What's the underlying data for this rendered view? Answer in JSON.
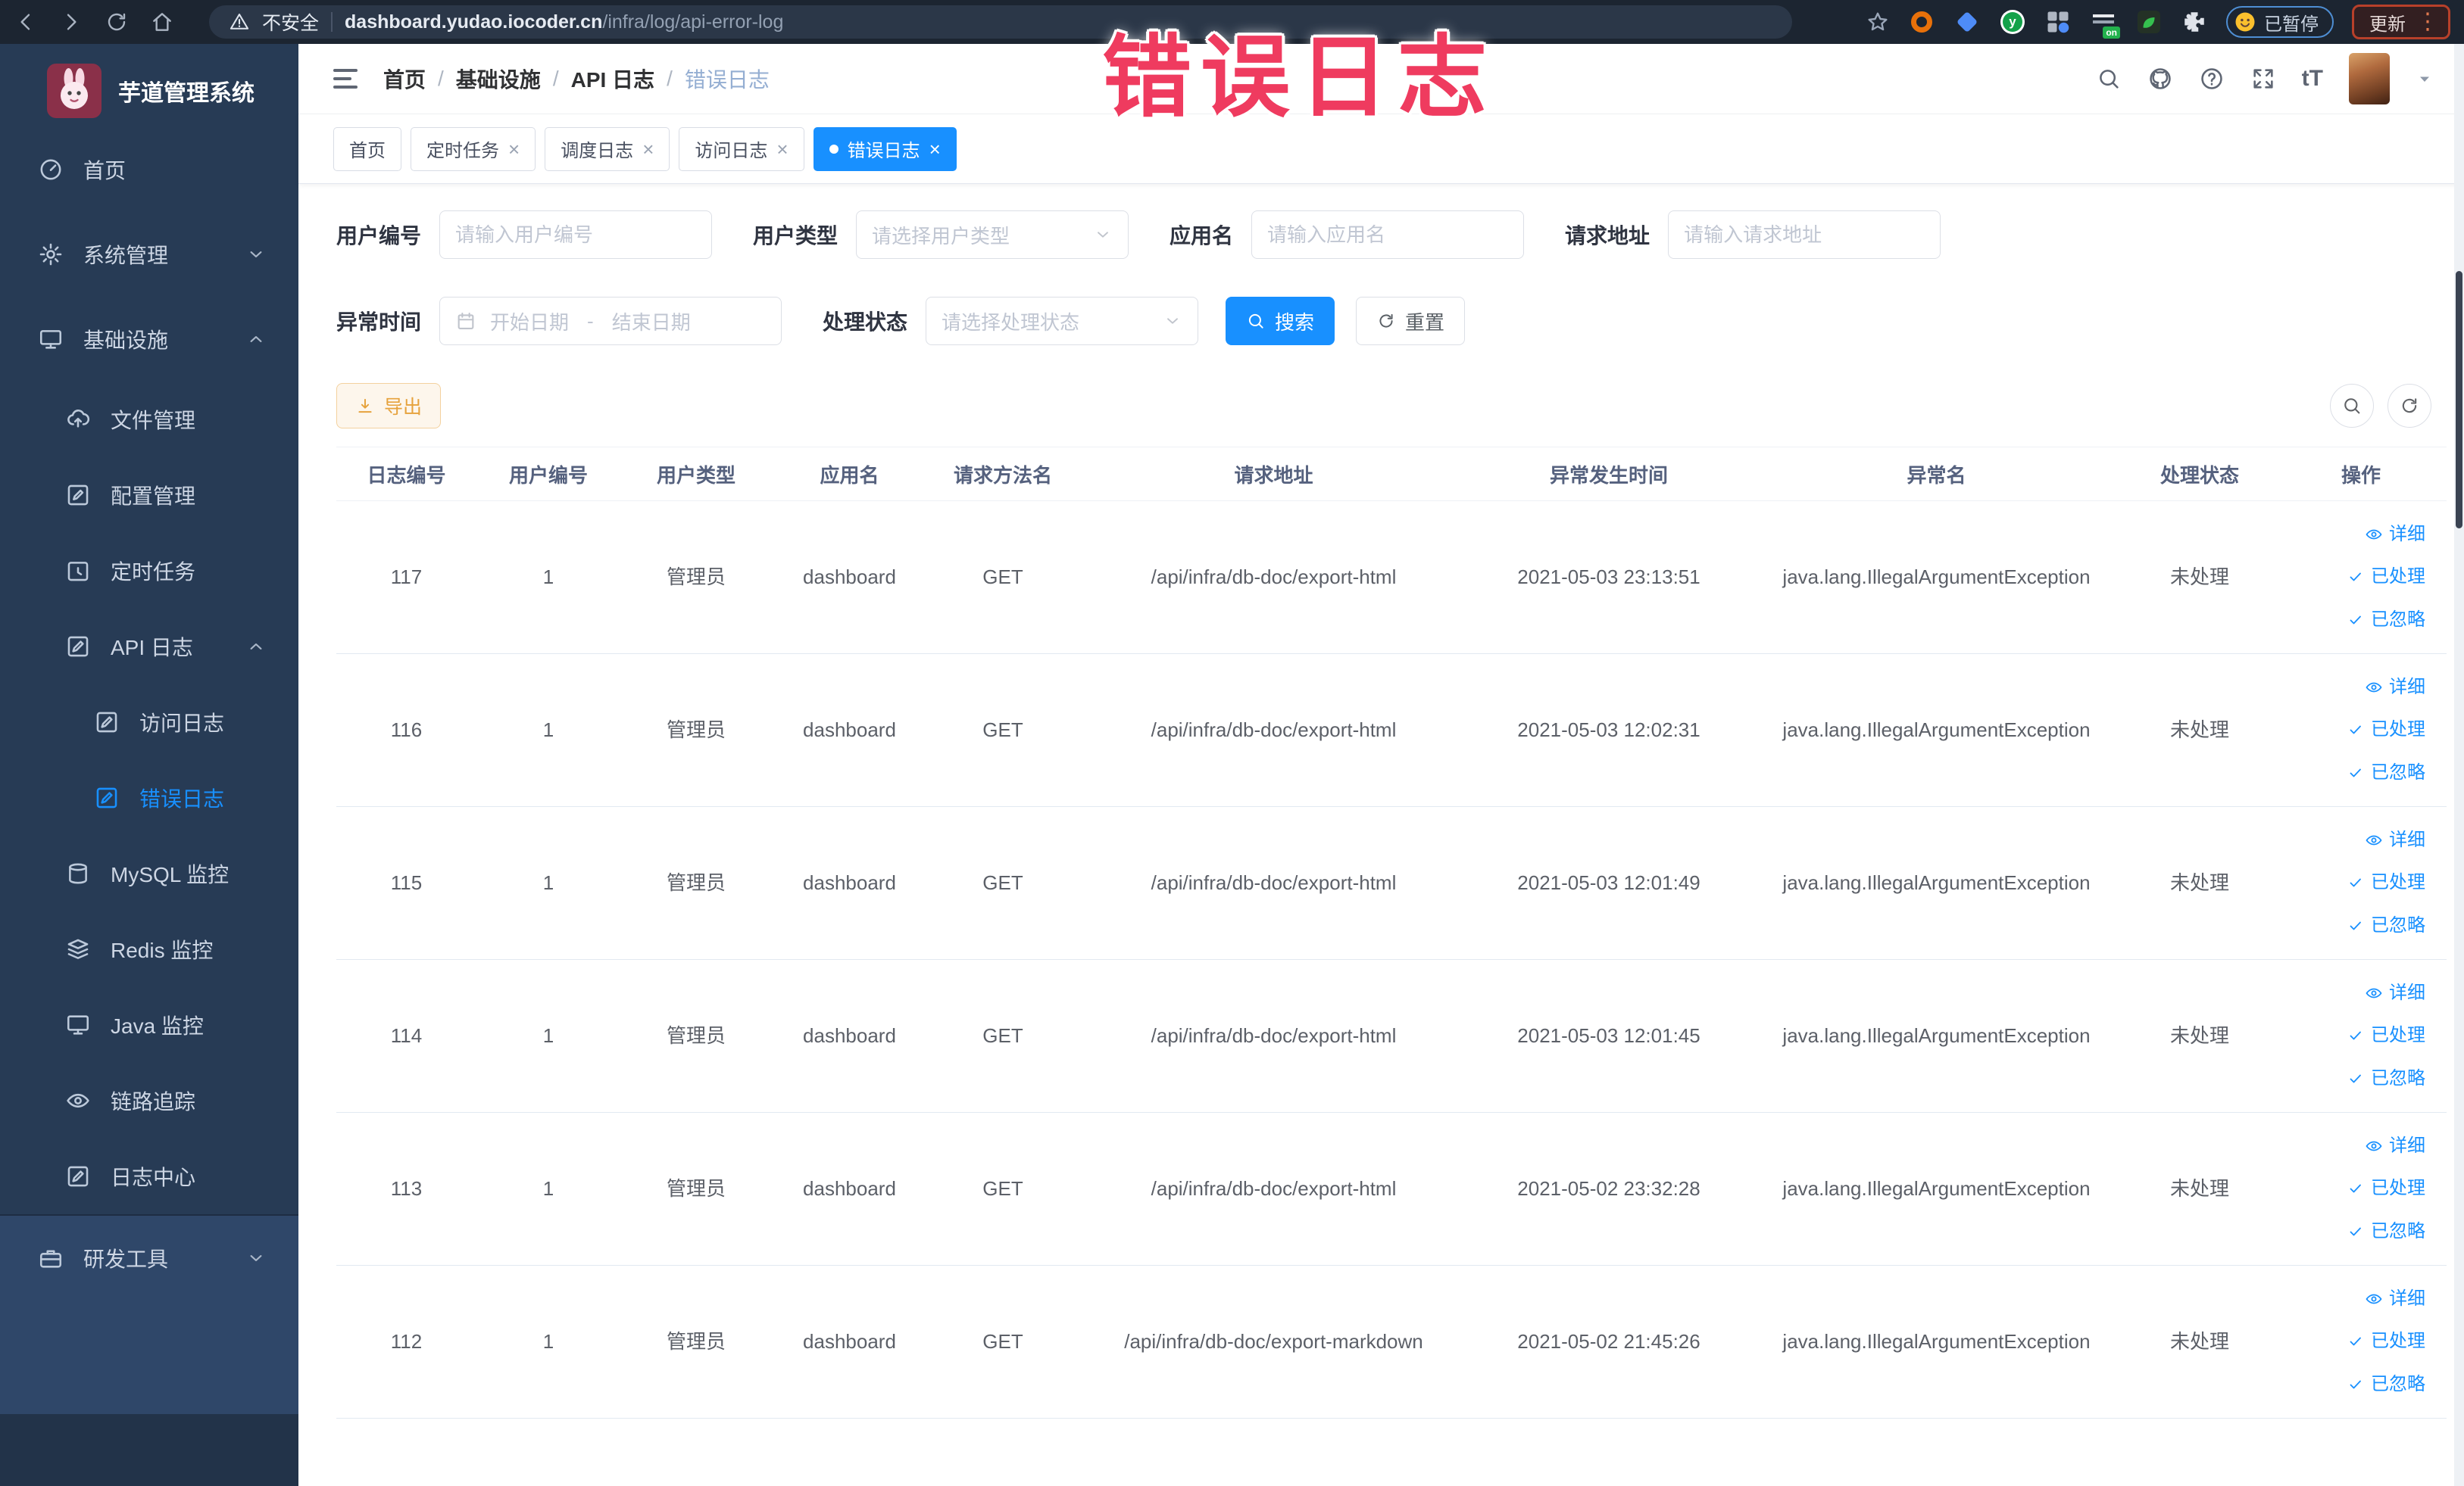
{
  "browser": {
    "security_label": "不安全",
    "url_host": "dashboard.yudao.iocoder.cn",
    "url_path": "/infra/log/api-error-log",
    "paused_badge": "已暂停",
    "update_button": "更新",
    "extensions": [
      {
        "name": "ext-orange-icon",
        "kind": "orange"
      },
      {
        "name": "ext-blue-icon",
        "kind": "blue"
      },
      {
        "name": "ext-green-icon",
        "kind": "green",
        "glyph": "y"
      },
      {
        "name": "ext-grid-icon",
        "kind": "grid"
      },
      {
        "name": "ext-switch-on-icon",
        "kind": "switch",
        "badge": "on"
      },
      {
        "name": "ext-leaf-icon",
        "kind": "leaf"
      },
      {
        "name": "extensions-puzzle-icon",
        "kind": "puzzle"
      }
    ]
  },
  "annotation": {
    "text": "错误日志"
  },
  "sidebar": {
    "title": "芋道管理系统",
    "items": [
      {
        "key": "home",
        "label": "首页",
        "icon": "home-icon",
        "level": 1
      },
      {
        "key": "system",
        "label": "系统管理",
        "icon": "gear-icon",
        "level": 1,
        "chevron": "down"
      },
      {
        "key": "infra",
        "label": "基础设施",
        "icon": "infrastructure-icon",
        "level": 1,
        "chevron": "up"
      },
      {
        "key": "file",
        "label": "文件管理",
        "icon": "file-upload-icon",
        "level": 2
      },
      {
        "key": "config",
        "label": "配置管理",
        "icon": "config-icon",
        "level": 2
      },
      {
        "key": "job",
        "label": "定时任务",
        "icon": "timer-icon",
        "level": 2
      },
      {
        "key": "api-log",
        "label": "API 日志",
        "icon": "api-log-icon",
        "level": 2,
        "chevron": "up"
      },
      {
        "key": "access-log",
        "label": "访问日志",
        "icon": "access-log-icon",
        "level": 3
      },
      {
        "key": "error-log",
        "label": "错误日志",
        "icon": "error-log-icon",
        "level": 3,
        "active": true
      },
      {
        "key": "mysql",
        "label": "MySQL 监控",
        "icon": "mysql-icon",
        "level": 2
      },
      {
        "key": "redis",
        "label": "Redis 监控",
        "icon": "redis-icon",
        "level": 2
      },
      {
        "key": "java",
        "label": "Java 监控",
        "icon": "java-icon",
        "level": 2
      },
      {
        "key": "trace",
        "label": "链路追踪",
        "icon": "trace-icon",
        "level": 2
      },
      {
        "key": "log-center",
        "label": "日志中心",
        "icon": "log-center-icon",
        "level": 2
      },
      {
        "key": "dev-tools",
        "label": "研发工具",
        "icon": "devtools-icon",
        "level": 1,
        "chevron": "down",
        "section": "alt"
      }
    ]
  },
  "breadcrumb": {
    "items": [
      "首页",
      "基础设施",
      "API 日志"
    ],
    "current": "错误日志"
  },
  "tabs": [
    {
      "label": "首页",
      "closable": false,
      "active": false
    },
    {
      "label": "定时任务",
      "closable": true,
      "active": false
    },
    {
      "label": "调度日志",
      "closable": true,
      "active": false
    },
    {
      "label": "访问日志",
      "closable": true,
      "active": false
    },
    {
      "label": "错误日志",
      "closable": true,
      "active": true
    }
  ],
  "filters": {
    "user_id": {
      "label": "用户编号",
      "placeholder": "请输入用户编号"
    },
    "user_type": {
      "label": "用户类型",
      "placeholder": "请选择用户类型"
    },
    "app_name": {
      "label": "应用名",
      "placeholder": "请输入应用名"
    },
    "request_url": {
      "label": "请求地址",
      "placeholder": "请输入请求地址"
    },
    "exception_time": {
      "label": "异常时间",
      "start_placeholder": "开始日期",
      "separator": "-",
      "end_placeholder": "结束日期"
    },
    "process_status": {
      "label": "处理状态",
      "placeholder": "请选择处理状态"
    },
    "search_label": "搜索",
    "reset_label": "重置"
  },
  "toolbar": {
    "export_label": "导出"
  },
  "table": {
    "columns": [
      {
        "key": "id",
        "label": "日志编号"
      },
      {
        "key": "user_id",
        "label": "用户编号"
      },
      {
        "key": "user_type",
        "label": "用户类型"
      },
      {
        "key": "app_name",
        "label": "应用名"
      },
      {
        "key": "method",
        "label": "请求方法名"
      },
      {
        "key": "url",
        "label": "请求地址"
      },
      {
        "key": "time",
        "label": "异常发生时间"
      },
      {
        "key": "exception",
        "label": "异常名"
      },
      {
        "key": "status",
        "label": "处理状态"
      },
      {
        "key": "actions",
        "label": "操作"
      }
    ],
    "rows": [
      {
        "id": "117",
        "user_id": "1",
        "user_type": "管理员",
        "app_name": "dashboard",
        "method": "GET",
        "url": "/api/infra/db-doc/export-html",
        "time": "2021-05-03 23:13:51",
        "exception": "java.lang.IllegalArgumentException",
        "status": "未处理"
      },
      {
        "id": "116",
        "user_id": "1",
        "user_type": "管理员",
        "app_name": "dashboard",
        "method": "GET",
        "url": "/api/infra/db-doc/export-html",
        "time": "2021-05-03 12:02:31",
        "exception": "java.lang.IllegalArgumentException",
        "status": "未处理"
      },
      {
        "id": "115",
        "user_id": "1",
        "user_type": "管理员",
        "app_name": "dashboard",
        "method": "GET",
        "url": "/api/infra/db-doc/export-html",
        "time": "2021-05-03 12:01:49",
        "exception": "java.lang.IllegalArgumentException",
        "status": "未处理"
      },
      {
        "id": "114",
        "user_id": "1",
        "user_type": "管理员",
        "app_name": "dashboard",
        "method": "GET",
        "url": "/api/infra/db-doc/export-html",
        "time": "2021-05-03 12:01:45",
        "exception": "java.lang.IllegalArgumentException",
        "status": "未处理"
      },
      {
        "id": "113",
        "user_id": "1",
        "user_type": "管理员",
        "app_name": "dashboard",
        "method": "GET",
        "url": "/api/infra/db-doc/export-html",
        "time": "2021-05-02 23:32:28",
        "exception": "java.lang.IllegalArgumentException",
        "status": "未处理"
      },
      {
        "id": "112",
        "user_id": "1",
        "user_type": "管理员",
        "app_name": "dashboard",
        "method": "GET",
        "url": "/api/infra/db-doc/export-markdown",
        "time": "2021-05-02 21:45:26",
        "exception": "java.lang.IllegalArgumentException",
        "status": "未处理"
      }
    ],
    "row_actions": [
      {
        "key": "detail",
        "label": "详细",
        "icon": "eye-icon"
      },
      {
        "key": "processed",
        "label": "已处理",
        "icon": "check-icon"
      },
      {
        "key": "ignored",
        "label": "已忽略",
        "icon": "check-icon"
      }
    ]
  },
  "colors": {
    "primary": "#1890ff",
    "warning": "#e6a23c",
    "annotation": "#ef3b5f",
    "sidebar_bg": "#273b55",
    "chrome_bg": "#1c2531"
  }
}
